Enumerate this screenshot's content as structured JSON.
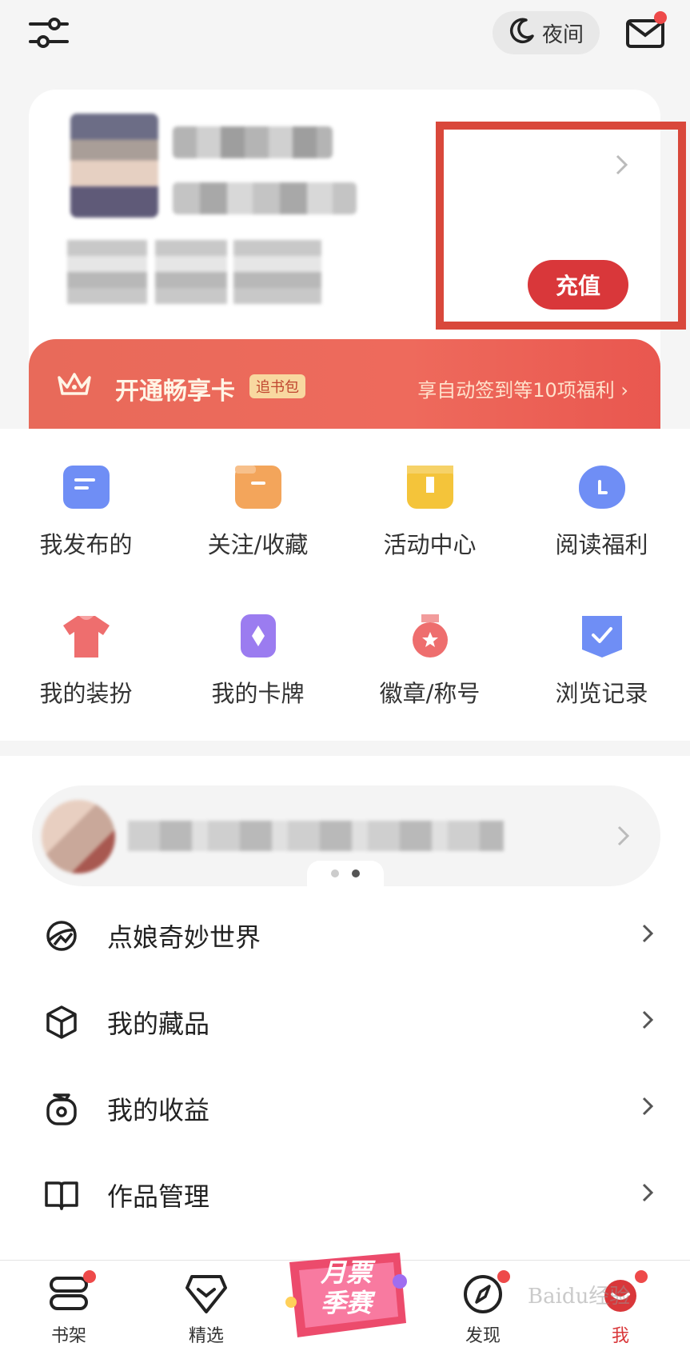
{
  "top_bar": {
    "night_label": "夜间"
  },
  "recharge": {
    "label": "充值"
  },
  "vip": {
    "title": "开通畅享卡",
    "tag": "追书包",
    "benefit": "享自动签到等10项福利"
  },
  "grid": [
    {
      "label": "我发布的",
      "icon": "comment-icon",
      "color": "#6f8ef5"
    },
    {
      "label": "关注/收藏",
      "icon": "folder-icon",
      "color": "#f3a55b"
    },
    {
      "label": "活动中心",
      "icon": "gift-icon",
      "color": "#f4c43a"
    },
    {
      "label": "阅读福利",
      "icon": "moneybag-icon",
      "color": "#6f8ef5"
    },
    {
      "label": "我的装扮",
      "icon": "shirt-icon",
      "color": "#ee6e6e"
    },
    {
      "label": "我的卡牌",
      "icon": "card-icon",
      "color": "#9b7cf0"
    },
    {
      "label": "徽章/称号",
      "icon": "medal-icon",
      "color": "#ee6e6e"
    },
    {
      "label": "浏览记录",
      "icon": "bookmark-check-icon",
      "color": "#6f8ef5"
    }
  ],
  "menu": [
    {
      "label": "点娘奇妙世界",
      "icon": "world-icon"
    },
    {
      "label": "我的藏品",
      "icon": "cube-icon"
    },
    {
      "label": "我的收益",
      "icon": "earnings-icon"
    },
    {
      "label": "作品管理",
      "icon": "book-icon"
    }
  ],
  "bottom_nav": [
    {
      "label": "书架",
      "icon": "bookshelf-icon"
    },
    {
      "label": "精选",
      "icon": "diamond-icon"
    },
    {
      "label": "发现",
      "icon": "compass-icon"
    },
    {
      "label": "我",
      "icon": "profile-icon"
    }
  ],
  "promo": {
    "line1": "月票",
    "line2": "季赛"
  },
  "watermark": "Baidu经验",
  "colors": {
    "accent": "#d9373a",
    "highlight": "#d9483b",
    "badge": "#ee4a4a"
  }
}
